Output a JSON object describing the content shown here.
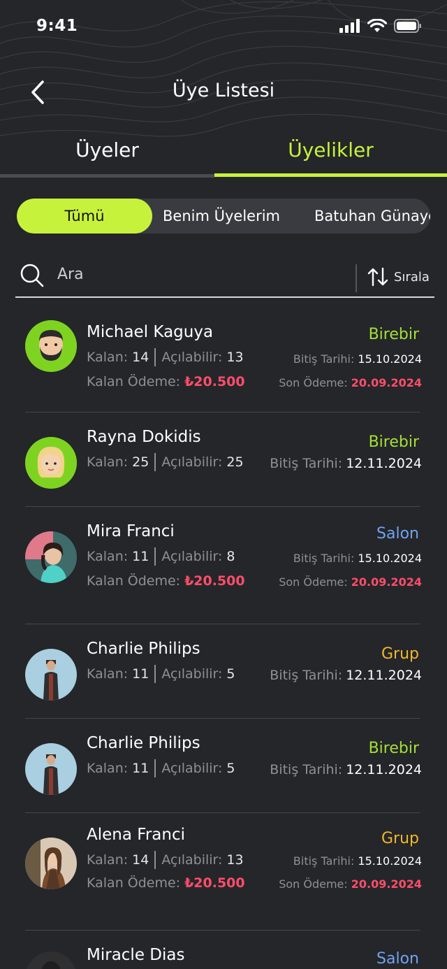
{
  "status_bar": {
    "time": "9:41"
  },
  "header": {
    "title": "Üye Listesi"
  },
  "main_tabs": [
    {
      "label": "Üyeler",
      "active": false
    },
    {
      "label": "Üyelikler",
      "active": true
    }
  ],
  "filters": [
    {
      "label": "Tümü",
      "active": true
    },
    {
      "label": "Benim Üyelerim",
      "active": false
    },
    {
      "label": "Batuhan Günaydın",
      "active": false
    }
  ],
  "search": {
    "placeholder": "Ara",
    "value": ""
  },
  "sort": {
    "label": "Sırala"
  },
  "labels": {
    "remaining": "Kalan:",
    "openable": "Açılabilir:",
    "remaining_payment": "Kalan Ödeme:",
    "end_date": "Bitiş Tarihi:",
    "last_payment": "Son Ödeme:"
  },
  "members": [
    {
      "name": "Michael Kaguya",
      "type": "Birebir",
      "remaining": "14",
      "openable": "13",
      "end_date": "15.10.2024",
      "remaining_payment": "₺20.500",
      "last_payment": "20.09.2024"
    },
    {
      "name": "Rayna Dokidis",
      "type": "Birebir",
      "remaining": "25",
      "openable": "25",
      "end_date": "12.11.2024"
    },
    {
      "name": "Mira Franci",
      "type": "Salon",
      "remaining": "11",
      "openable": "8",
      "end_date": "15.10.2024",
      "remaining_payment": "₺20.500",
      "last_payment": "20.09.2024"
    },
    {
      "name": "Charlie Philips",
      "type": "Grup",
      "remaining": "11",
      "openable": "5",
      "end_date": "12.11.2024"
    },
    {
      "name": "Charlie Philips",
      "type": "Birebir",
      "remaining": "11",
      "openable": "5",
      "end_date": "12.11.2024"
    },
    {
      "name": "Alena Franci",
      "type": "Grup",
      "remaining": "14",
      "openable": "13",
      "end_date": "15.10.2024",
      "remaining_payment": "₺20.500",
      "last_payment": "20.09.2024"
    },
    {
      "name": "Miracle Dias",
      "type": "Salon"
    }
  ],
  "colors": {
    "accent": "#c7f23c",
    "birebir": "#a4e036",
    "salon": "#6ea4f0",
    "grup": "#f0b82a",
    "payment": "#ff4d6a",
    "background": "#25262a"
  }
}
